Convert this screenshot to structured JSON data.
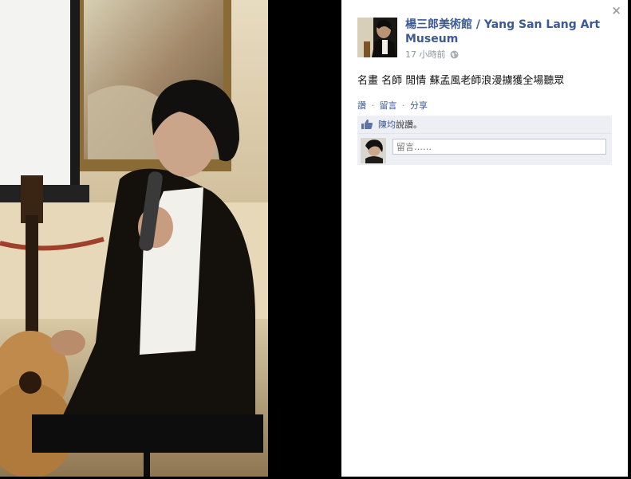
{
  "post": {
    "page_name": "楊三郎美術館 / Yang San Lang Art Museum",
    "time": "17 小時前",
    "text": "名畫 名師 閒情 蘇孟風老師浪漫擄獲全場聽眾"
  },
  "actions": {
    "like": "讚",
    "comment": "留言",
    "share": "分享",
    "separator": "·"
  },
  "feedback": {
    "liker": "陳均",
    "liker_suffix": "說讚。",
    "comment_placeholder": "留言……"
  },
  "viewer": {
    "close_label": "×"
  },
  "icons": {
    "close": "close-icon",
    "globe": "globe-icon",
    "thumb": "thumbs-up-icon"
  },
  "colors": {
    "link": "#3b5998",
    "feedback_bg": "#edeff4"
  }
}
